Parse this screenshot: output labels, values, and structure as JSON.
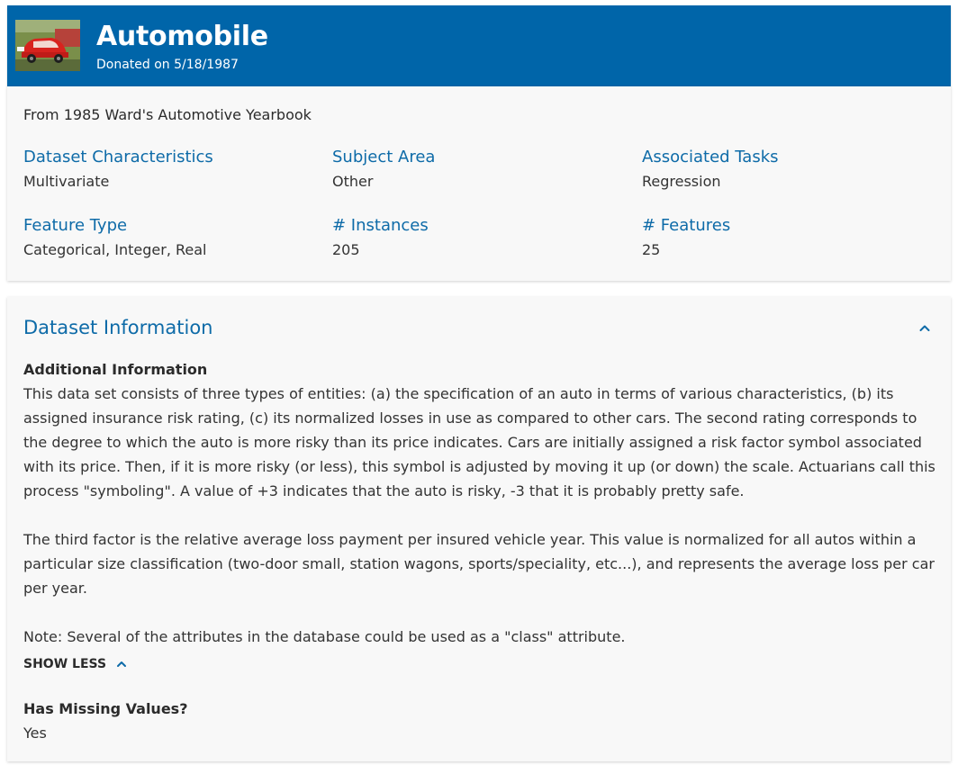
{
  "header": {
    "title": "Automobile",
    "donated": "Donated on 5/18/1987",
    "thumbnail_icon": "red-car-photo"
  },
  "summary": {
    "abstract": "From 1985 Ward's Automotive Yearbook",
    "characteristics": [
      {
        "label": "Dataset Characteristics",
        "value": "Multivariate"
      },
      {
        "label": "Subject Area",
        "value": "Other"
      },
      {
        "label": "Associated Tasks",
        "value": "Regression"
      },
      {
        "label": "Feature Type",
        "value": "Categorical, Integer, Real"
      },
      {
        "label": "# Instances",
        "value": "205"
      },
      {
        "label": "# Features",
        "value": "25"
      }
    ]
  },
  "info": {
    "heading": "Dataset Information",
    "additional_title": "Additional Information",
    "paragraphs": [
      "This data set consists of three types of entities: (a) the specification of an auto in terms of various characteristics, (b) its assigned insurance risk rating, (c) its normalized losses in use as compared to other cars.  The second rating corresponds to the degree to which the auto is more risky than its price indicates. Cars are initially assigned a risk factor symbol associated with its price.  Then, if it is more risky (or less), this symbol is adjusted by moving it up (or down) the scale.  Actuarians call this process \"symboling\".  A value of +3 indicates that the auto is risky, -3 that it is probably pretty safe.",
      "The third factor is the relative average loss payment per insured vehicle year.  This value is normalized for all autos within a particular size classification (two-door small, station wagons, sports/speciality, etc...), and represents the average loss per car per year.",
      "Note: Several of the attributes in the database could be used as a \"class\" attribute."
    ],
    "show_less_label": "SHOW LESS",
    "missing_title": "Has Missing Values?",
    "missing_value": "Yes"
  },
  "colors": {
    "header_bg": "#0065a9",
    "accent": "#0e6ba8",
    "card_bg": "#f8f8f8"
  }
}
